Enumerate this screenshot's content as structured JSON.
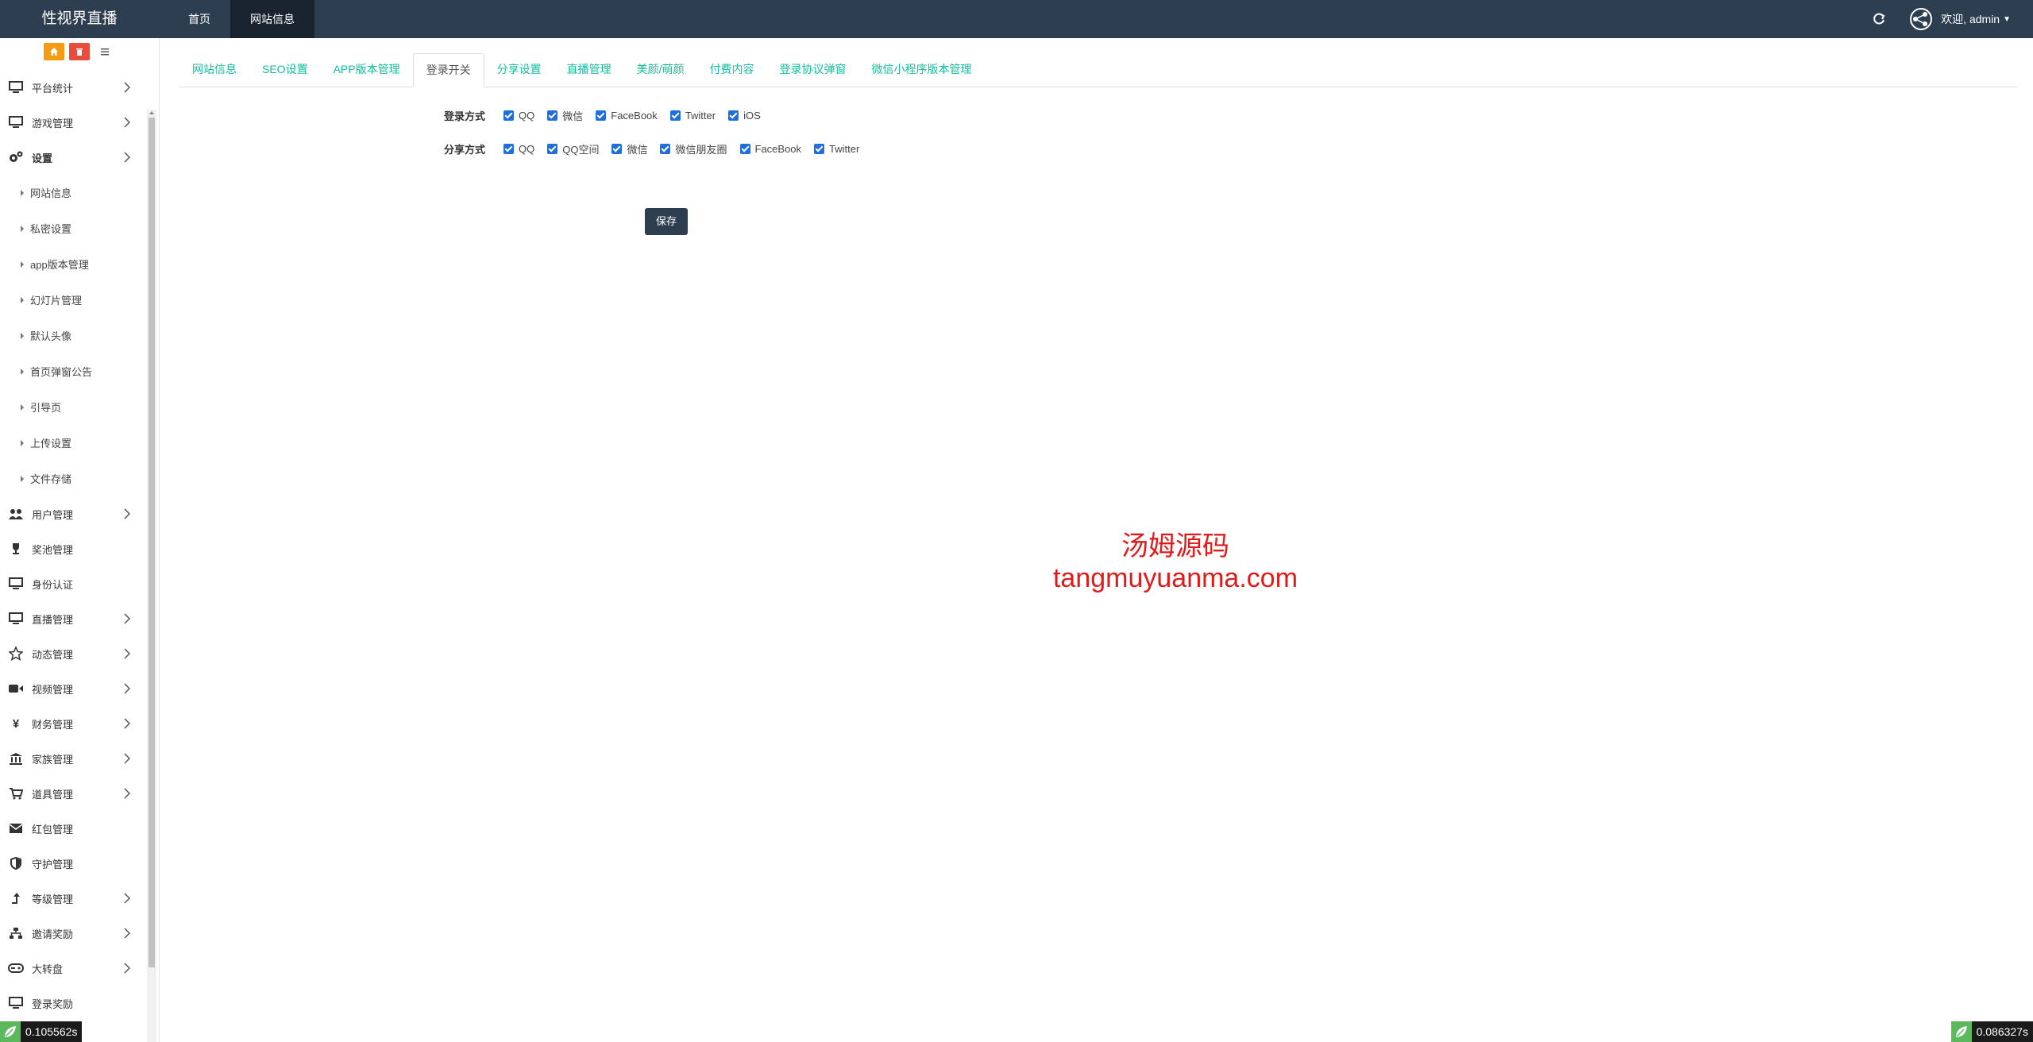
{
  "brand": "性视界直播",
  "topnav": [
    {
      "label": "首页"
    },
    {
      "label": "网站信息"
    }
  ],
  "user": {
    "welcome": "欢迎, admin"
  },
  "sidebar": {
    "shortcut_icons": [
      "home-icon",
      "trash-icon",
      "list-icon"
    ],
    "items": [
      {
        "label": "平台统计",
        "icon": "monitor-icon",
        "has_children": true
      },
      {
        "label": "游戏管理",
        "icon": "monitor-icon",
        "has_children": true
      },
      {
        "label": "设置",
        "icon": "gears-icon",
        "has_children": true,
        "expanded": true,
        "children": [
          "网站信息",
          "私密设置",
          "app版本管理",
          "幻灯片管理",
          "默认头像",
          "首页弹窗公告",
          "引导页",
          "上传设置",
          "文件存储"
        ]
      },
      {
        "label": "用户管理",
        "icon": "users-icon",
        "has_children": true
      },
      {
        "label": "奖池管理",
        "icon": "trophy-icon",
        "has_children": false
      },
      {
        "label": "身份认证",
        "icon": "monitor-icon",
        "has_children": false
      },
      {
        "label": "直播管理",
        "icon": "monitor-icon",
        "has_children": true
      },
      {
        "label": "动态管理",
        "icon": "star-icon",
        "has_children": true
      },
      {
        "label": "视频管理",
        "icon": "video-camera-icon",
        "has_children": true
      },
      {
        "label": "财务管理",
        "icon": "yen-icon",
        "has_children": true
      },
      {
        "label": "家族管理",
        "icon": "bank-icon",
        "has_children": true
      },
      {
        "label": "道具管理",
        "icon": "cart-icon",
        "has_children": true
      },
      {
        "label": "红包管理",
        "icon": "envelope-icon",
        "has_children": false
      },
      {
        "label": "守护管理",
        "icon": "shield-icon",
        "has_children": false
      },
      {
        "label": "等级管理",
        "icon": "level-up-icon",
        "has_children": true
      },
      {
        "label": "邀请奖励",
        "icon": "sitemap-icon",
        "has_children": true
      },
      {
        "label": "大转盘",
        "icon": "gamepad-icon",
        "has_children": true
      },
      {
        "label": "登录奖励",
        "icon": "monitor-icon",
        "has_children": false
      }
    ]
  },
  "tabs": [
    "网站信息",
    "SEO设置",
    "APP版本管理",
    "登录开关",
    "分享设置",
    "直播管理",
    "美颜/萌颜",
    "付费内容",
    "登录协议弹窗",
    "微信小程序版本管理"
  ],
  "active_tab": "登录开关",
  "form": {
    "login": {
      "label": "登录方式",
      "options": [
        "QQ",
        "微信",
        "FaceBook",
        "Twitter",
        "iOS"
      ]
    },
    "share": {
      "label": "分享方式",
      "options": [
        "QQ",
        "QQ空间",
        "微信",
        "微信朋友圈",
        "FaceBook",
        "Twitter"
      ]
    },
    "save_label": "保存"
  },
  "watermark": {
    "line1": "汤姆源码",
    "line2": "tangmuyuanma.com"
  },
  "timers": {
    "left": "0.105562s",
    "right": "0.086327s"
  },
  "colors": {
    "topbar": "#2c3e50",
    "tab_link": "#18bc9c",
    "checkbox": "#1e6fd9",
    "watermark": "#e01b1b"
  }
}
